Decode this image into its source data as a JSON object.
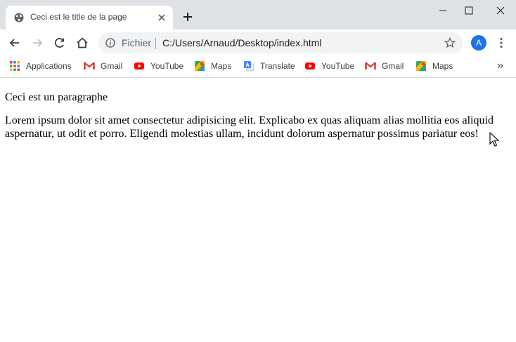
{
  "window": {
    "tab_title": "Ceci est le title de la page"
  },
  "toolbar": {
    "scheme_label": "Fichier",
    "url": "C:/Users/Arnaud/Desktop/index.html",
    "avatar_letter": "A"
  },
  "bookmarks": [
    {
      "label": "Applications",
      "icon": "apps-grid-icon"
    },
    {
      "label": "Gmail",
      "icon": "gmail-icon"
    },
    {
      "label": "YouTube",
      "icon": "youtube-icon"
    },
    {
      "label": "Maps",
      "icon": "maps-icon"
    },
    {
      "label": "Translate",
      "icon": "translate-icon"
    },
    {
      "label": "YouTube",
      "icon": "youtube-icon"
    },
    {
      "label": "Gmail",
      "icon": "gmail-icon"
    },
    {
      "label": "Maps",
      "icon": "maps-icon"
    }
  ],
  "page": {
    "paragraph_1": "Ceci est un paragraphe",
    "paragraph_2": "Lorem ipsum dolor sit amet consectetur adipisicing elit. Explicabo ex quas aliquam alias mollitia eos aliquid aspernatur, ut odit et porro. Eligendi molestias ullam, incidunt dolorum aspernatur possimus pariatur eos!"
  },
  "colors": {
    "titlebar": "#dee1e6",
    "omnibox": "#f1f3f4",
    "avatar": "#1a73e8",
    "youtube_red": "#ff0000",
    "gmail_red": "#d93025"
  }
}
